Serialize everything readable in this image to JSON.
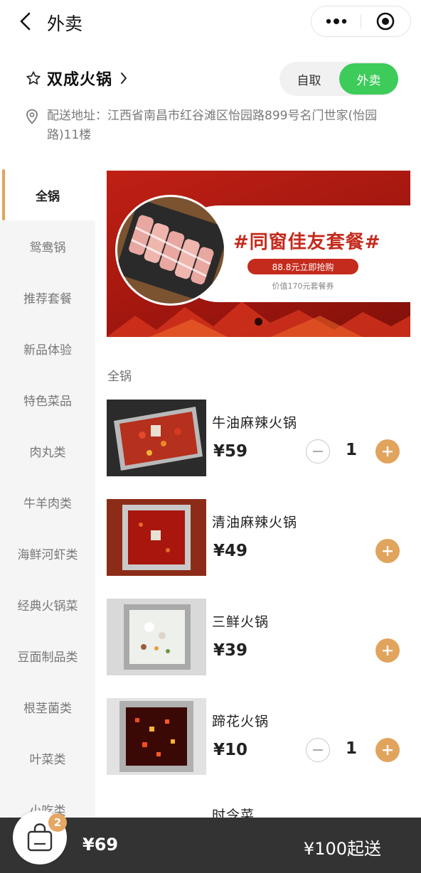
{
  "nav": {
    "title": "外卖",
    "back_icon": "chevron-left-icon",
    "more_icon": "more-dots-icon",
    "close_icon": "target-circle-icon"
  },
  "store": {
    "name": "双成火锅",
    "star_icon": "star-outline-icon",
    "modes": [
      "自取",
      "外卖"
    ],
    "active_mode": "外卖",
    "address": "配送地址：江西省南昌市红谷滩区怡园路899号名门世家(怡园路)11楼",
    "address_icon": "location-pin-icon"
  },
  "sidebar": {
    "items": [
      {
        "label": "全锅",
        "active": true
      },
      {
        "label": "鸳鸯锅"
      },
      {
        "label": "推荐套餐"
      },
      {
        "label": "新品体验"
      },
      {
        "label": "特色菜品"
      },
      {
        "label": "肉丸类"
      },
      {
        "label": "牛羊肉类"
      },
      {
        "label": "海鲜河虾类"
      },
      {
        "label": "经典火锅菜"
      },
      {
        "label": "豆面制品类"
      },
      {
        "label": "根茎菌类"
      },
      {
        "label": "叶菜类"
      },
      {
        "label": "小吃类"
      }
    ]
  },
  "banner": {
    "title": "#同窗佳友套餐#",
    "cta": "88.8元立即抢购",
    "subtitle": "价值170元套餐券",
    "accent": "#c42b1d"
  },
  "section": {
    "title": "全锅"
  },
  "products": [
    {
      "name": "牛油麻辣火锅",
      "price": "¥59",
      "qty": "1",
      "has_qty": true
    },
    {
      "name": "清油麻辣火锅",
      "price": "¥49",
      "qty": "",
      "has_qty": false
    },
    {
      "name": "三鲜火锅",
      "price": "¥39",
      "qty": "",
      "has_qty": false
    },
    {
      "name": "蹄花火锅",
      "price": "¥10",
      "qty": "1",
      "has_qty": true
    }
  ],
  "partial_next_product": "时令菜",
  "cart": {
    "badge": "2",
    "total": "¥69",
    "min_order": "¥100起送",
    "icon": "shopping-bag-icon"
  },
  "colors": {
    "primary_green": "#3dcb5a",
    "accent_orange": "#e1a45d",
    "cart_bar": "#333333"
  }
}
